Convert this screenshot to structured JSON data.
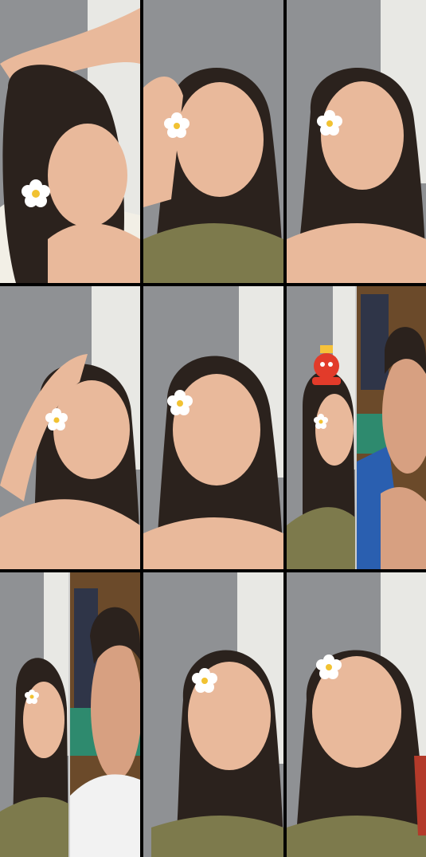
{
  "layout": {
    "rows": 3,
    "cols": 3
  },
  "tiles": [
    {
      "scene": "woman-hand-on-head-close",
      "flower": true
    },
    {
      "scene": "woman-pout",
      "flower": true
    },
    {
      "scene": "woman-neutral",
      "flower": true
    },
    {
      "scene": "woman-hand-on-head",
      "flower": true
    },
    {
      "scene": "woman-neutral",
      "flower": true
    },
    {
      "scene": "split-woman-and-man",
      "flower": true,
      "badge": true
    },
    {
      "scene": "split-woman-and-man",
      "flower": true
    },
    {
      "scene": "woman-neutral",
      "flower": true
    },
    {
      "scene": "woman-neutral",
      "flower": true
    }
  ],
  "colors": {
    "background": "#000000",
    "curtain": "#8f9194",
    "wall": "#e8e8e4",
    "skin": "#e9b99b",
    "hair": "#2b221d",
    "top": "#7d7a4c",
    "flower": "#ffffff",
    "flower_center": "#f1c232",
    "man_wall": "#6b4a2a",
    "man_skin": "#d7a081",
    "man_shirt": "#f2f2f2"
  }
}
